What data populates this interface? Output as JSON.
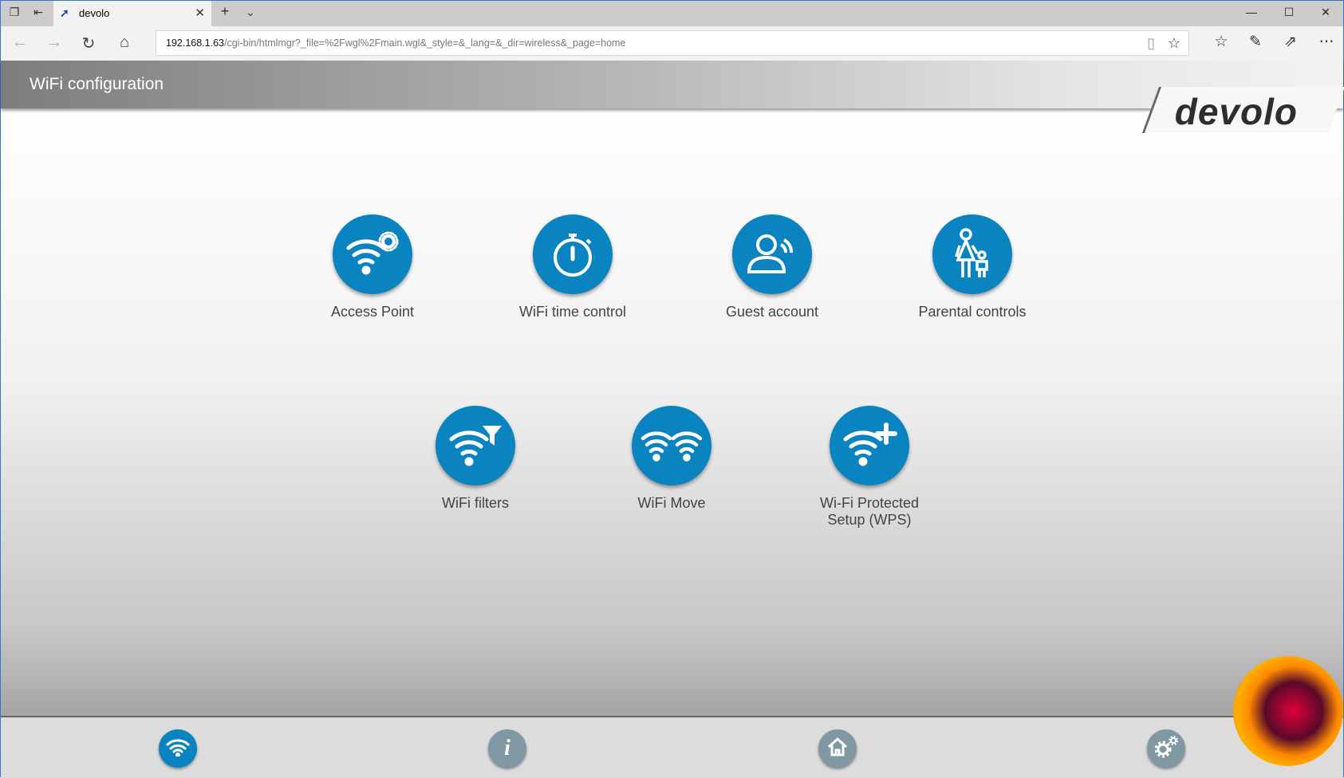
{
  "browser": {
    "tab_title": "devolo",
    "url_host": "192.168.1.63",
    "url_path": "/cgi-bin/htmlmgr?_file=%2Fwgl%2Fmain.wgl&_style=&_lang=&_dir=wireless&_page=home"
  },
  "header": {
    "title": "WiFi configuration",
    "logo": "devolo"
  },
  "tiles": [
    {
      "label": "Access Point",
      "icon": "wifi-gear-icon"
    },
    {
      "label": "WiFi time control",
      "icon": "stopwatch-icon"
    },
    {
      "label": "Guest account",
      "icon": "guest-user-icon"
    },
    {
      "label": "Parental controls",
      "icon": "parent-child-icon"
    },
    {
      "label": "WiFi filters",
      "icon": "wifi-filter-icon"
    },
    {
      "label": "WiFi Move",
      "icon": "wifi-move-icon"
    },
    {
      "label": "Wi-Fi Protected Setup (WPS)",
      "icon": "wifi-plus-icon"
    }
  ],
  "bottom_nav": [
    {
      "name": "wifi",
      "icon": "wifi-icon",
      "active": true
    },
    {
      "name": "info",
      "icon": "info-icon"
    },
    {
      "name": "home",
      "icon": "home-icon"
    },
    {
      "name": "settings",
      "icon": "gears-icon"
    }
  ],
  "colors": {
    "accent": "#0a84c0",
    "inactive": "#7f98a3"
  }
}
